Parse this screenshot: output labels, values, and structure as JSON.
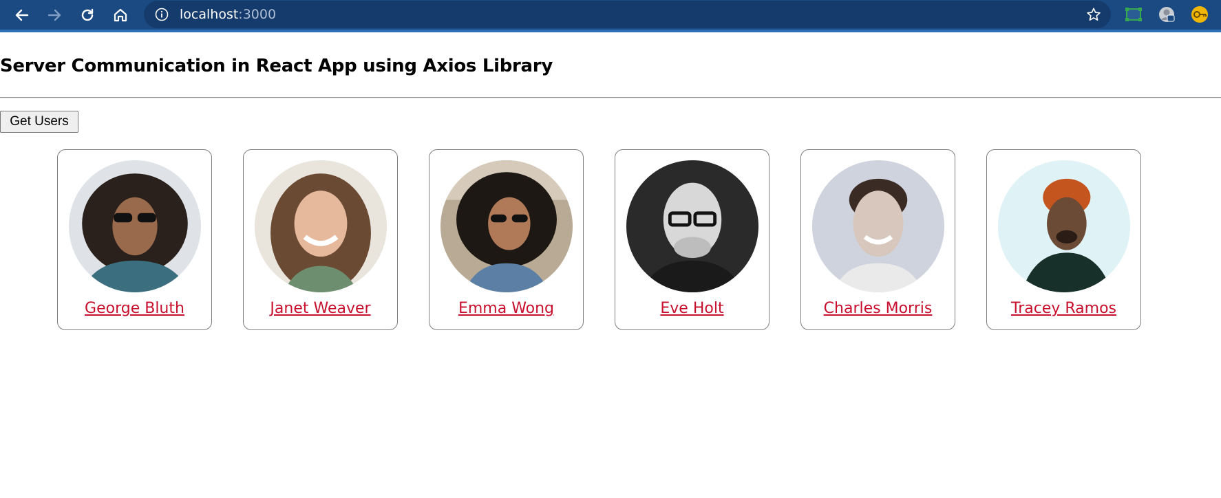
{
  "browser": {
    "url_host": "localhost",
    "url_port": ":3000",
    "icons": [
      "back-icon",
      "forward-icon",
      "reload-icon",
      "home-icon",
      "site-info-icon",
      "bookmark-star-icon",
      "screen-capture-extension-icon",
      "profile-extension-icon",
      "key-extension-icon"
    ]
  },
  "page": {
    "title": "Server Communication in React App using Axios Library",
    "get_users_label": "Get Users"
  },
  "users": [
    {
      "name": "George Bluth"
    },
    {
      "name": "Janet Weaver"
    },
    {
      "name": "Emma Wong"
    },
    {
      "name": "Eve Holt"
    },
    {
      "name": "Charles Morris"
    },
    {
      "name": "Tracey Ramos"
    }
  ],
  "colors": {
    "toolbar": "#1b4a82",
    "omnibox": "#143b6b",
    "link": "#c8102e"
  }
}
